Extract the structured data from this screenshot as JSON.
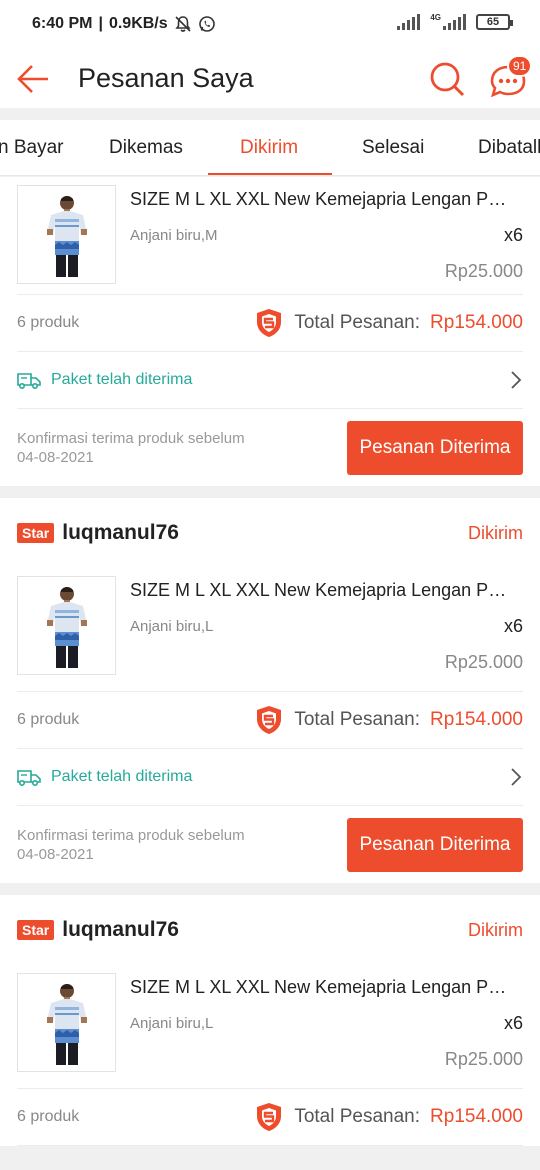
{
  "status_bar": {
    "time": "6:40 PM",
    "speed": "0.9KB/s",
    "network": "4G",
    "battery": "65",
    "icons": [
      "mute-icon",
      "whatsapp-icon",
      "signal-icon",
      "battery-icon"
    ]
  },
  "header": {
    "title": "Pesanan Saya",
    "chat_badge": "91",
    "icons": [
      "back-arrow-icon",
      "search-icon",
      "chat-icon"
    ]
  },
  "tabs": [
    {
      "label": "n Bayar"
    },
    {
      "label": "Dikemas"
    },
    {
      "label": "Dikirim"
    },
    {
      "label": "Selesai"
    },
    {
      "label": "Dibatalk"
    }
  ],
  "active_tab": "Dikirim",
  "orders": [
    {
      "shop_badge": "",
      "shop_name": "",
      "status": "",
      "product_name": "SIZE M L XL XXL New Kemejapria Lengan Pendek",
      "variant": "Anjani biru,M",
      "qty": "x6",
      "price": "Rp25.000",
      "count": "6 produk",
      "total_label": "Total Pesanan:",
      "total_amount": "Rp154.000",
      "shipping": "Paket telah diterima",
      "confirm_line1": "Konfirmasi terima produk sebelum",
      "confirm_line2": "04-08-2021",
      "button": "Pesanan Diterima"
    },
    {
      "shop_badge": "Star",
      "shop_name": "luqmanul76",
      "status": "Dikirim",
      "product_name": "SIZE M L XL XXL New Kemejapria Lengan Pendek",
      "variant": "Anjani biru,L",
      "qty": "x6",
      "price": "Rp25.000",
      "count": "6 produk",
      "total_label": "Total Pesanan:",
      "total_amount": "Rp154.000",
      "shipping": "Paket telah diterima",
      "confirm_line1": "Konfirmasi terima produk sebelum",
      "confirm_line2": "04-08-2021",
      "button": "Pesanan Diterima"
    },
    {
      "shop_badge": "Star",
      "shop_name": "luqmanul76",
      "status": "Dikirim",
      "product_name": "SIZE M L XL XXL New Kemejapria Lengan Pendek",
      "variant": "Anjani biru,L",
      "qty": "x6",
      "price": "Rp25.000",
      "count": "6 produk",
      "total_label": "Total Pesanan:",
      "total_amount": "Rp154.000"
    }
  ],
  "colors": {
    "accent": "#ee4d2d",
    "shipping": "#26aa99"
  }
}
